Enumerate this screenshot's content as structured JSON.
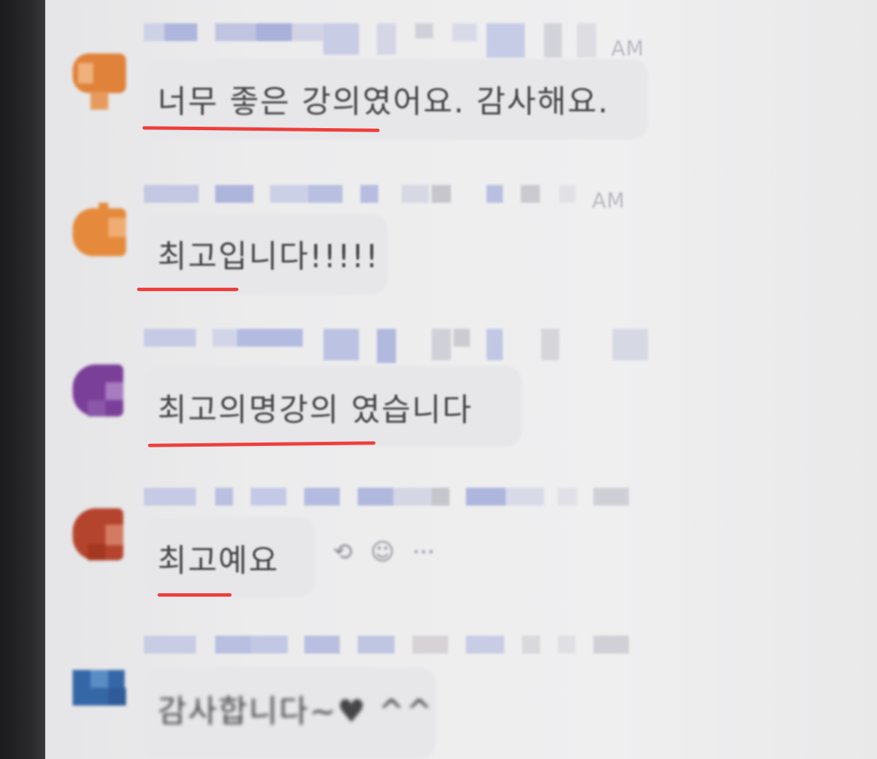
{
  "chat": {
    "messages": [
      {
        "time": "AM",
        "text": "너무 좋은 강의였어요. 감사해요.",
        "avatar_color": "#e0823a"
      },
      {
        "time": "AM",
        "text": "최고입니다!!!!!",
        "avatar_color": "#e58a3c"
      },
      {
        "time": "",
        "text": "최고의명강의 였습니다",
        "avatar_color": "#7a3f98"
      },
      {
        "time": "",
        "text": "최고예요",
        "avatar_color": "#b5442e"
      },
      {
        "time": "",
        "text": "감사합니다~♥ ^^",
        "avatar_color": "#3567a6"
      }
    ],
    "hover_actions": {
      "reply_icon": "reply-icon",
      "emoji_icon": "add-reaction-icon",
      "more_icon": "more-options-icon",
      "reply_glyph": "⟲",
      "emoji_glyph": "☺",
      "more_glyph": "···"
    }
  },
  "colors": {
    "annotation_underline": "#ef3f3c",
    "bubble": "#e7e7ea",
    "text": "#454548"
  }
}
